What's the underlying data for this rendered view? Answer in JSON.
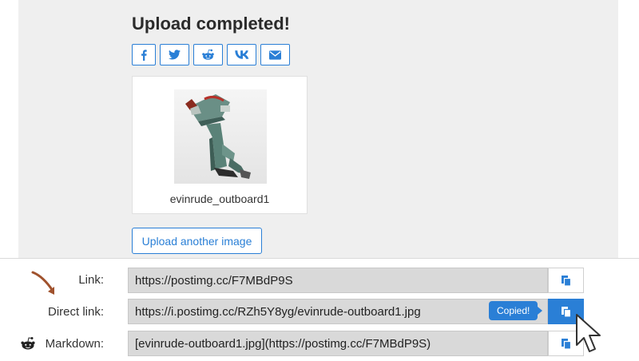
{
  "header": {
    "title": "Upload completed!"
  },
  "share_buttons": [
    {
      "icon": "facebook-icon"
    },
    {
      "icon": "twitter-icon"
    },
    {
      "icon": "reddit-icon"
    },
    {
      "icon": "vk-icon"
    },
    {
      "icon": "email-icon"
    }
  ],
  "thumbnail": {
    "filename": "evinrude_outboard1"
  },
  "actions": {
    "upload_another": "Upload another image"
  },
  "links": {
    "link": {
      "label": "Link:",
      "value": "https://postimg.cc/F7MBdP9S"
    },
    "direct": {
      "label": "Direct link:",
      "value": "https://i.postimg.cc/RZh5Y8yg/evinrude-outboard1.jpg"
    },
    "markdown": {
      "label": "Markdown:",
      "value": "[evinrude-outboard1.jpg](https://postimg.cc/F7MBdP9S)"
    }
  },
  "tooltip": {
    "text": "Copied!"
  },
  "colors": {
    "accent": "#2a7fd6",
    "panel": "#efefef",
    "field": "#d9d9d9",
    "arrow": "#a0522d"
  }
}
